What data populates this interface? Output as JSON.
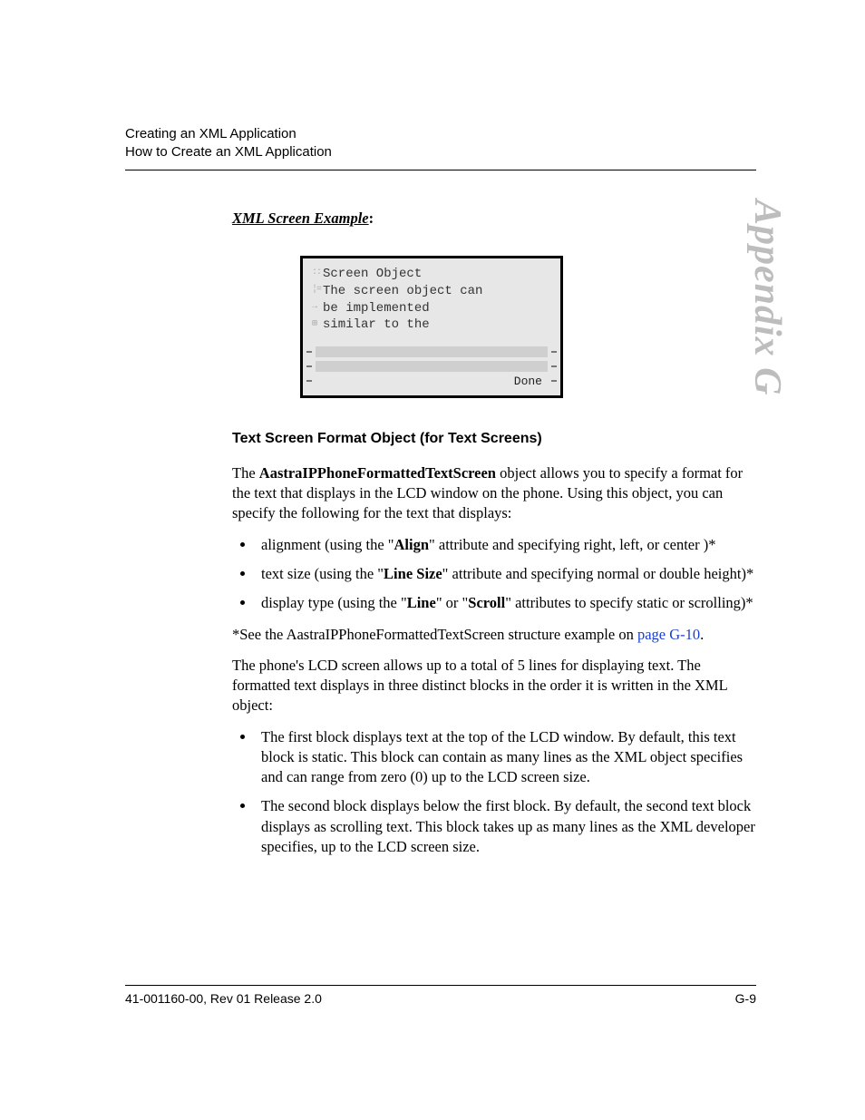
{
  "header": {
    "line1": "Creating an XML Application",
    "line2": "How to Create an XML Application"
  },
  "sideTab": "Appendix G",
  "exampleTitle": "XML Screen Example",
  "exampleColon": ":",
  "screen": {
    "lines": [
      "Screen Object",
      "The screen object can",
      "be implemented",
      "similar to the"
    ],
    "softkeys": [
      "",
      "",
      "Done"
    ]
  },
  "sectionHeading": "Text Screen Format Object (for Text Screens)",
  "para1a": "The ",
  "para1bold": "AastraIPPhoneFormattedTextScreen",
  "para1b": " object allows you to specify a format for the text that displays in the LCD window on the phone. Using this object, you can specify the following for the text that displays:",
  "bullets1": {
    "b1a": "alignment (using the \"",
    "b1bold": "Align",
    "b1b": "\" attribute and specifying right, left, or center )*",
    "b2a": "text size (using the \"",
    "b2bold": "Line Size",
    "b2b": "\" attribute and specifying normal or double height)*",
    "b3a": "display type (using the \"",
    "b3bold1": "Line",
    "b3b": "\" or \"",
    "b3bold2": "Scroll",
    "b3c": "\" attributes to specify static or scrolling)*"
  },
  "footnoteA": "*See the AastraIPPhoneFormattedTextScreen structure example on ",
  "footnoteLink": "page G-10",
  "footnoteB": ".",
  "para2": "The phone's LCD screen allows up to a total of 5 lines for displaying text. The formatted text displays in three distinct blocks in the order it is written in the XML object:",
  "bullets2": [
    "The first block displays text at the top of the LCD window. By default, this text block is static. This block can contain as many lines as the XML object specifies and can range from zero (0) up to the LCD screen size.",
    "The second block displays below the first block. By default, the second text block displays as scrolling text. This block takes up as many lines as the XML developer specifies, up to the LCD screen size."
  ],
  "footer": {
    "left": "41-001160-00, Rev 01 Release 2.0",
    "right": "G-9"
  }
}
